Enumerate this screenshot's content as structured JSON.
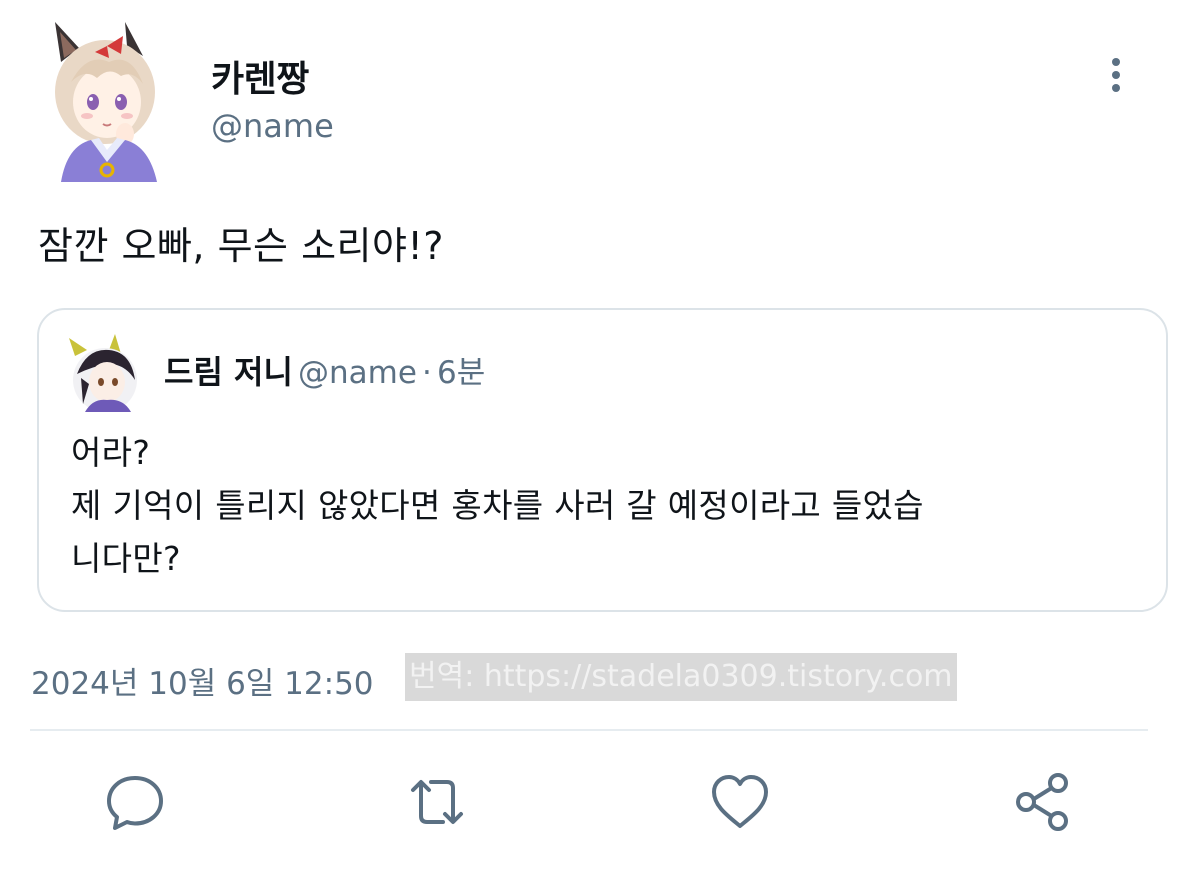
{
  "tweet": {
    "author_name": "카렌짱",
    "author_handle": "@name",
    "text": "잠깐 오빠, 무슨 소리야!?",
    "timestamp": "2024년 10월 6일  12:50"
  },
  "quoted_tweet": {
    "author_name": "드림 저니",
    "author_handle": "@name",
    "separator": "·",
    "time_ago": "6분",
    "lines": [
      "어라?",
      "제 기억이 틀리지 않았다면 홍차를 사러 갈 예정이라고 들었습",
      "니다만?"
    ]
  },
  "watermark": "번역: https://stadela0309.tistory.com",
  "icons": {
    "more": "more-vertical-icon",
    "reply": "reply-icon",
    "retweet": "retweet-icon",
    "like": "heart-icon",
    "share": "share-icon"
  },
  "colors": {
    "text_primary": "#0f1419",
    "text_secondary": "#5b7083",
    "border": "#dce3e8"
  }
}
